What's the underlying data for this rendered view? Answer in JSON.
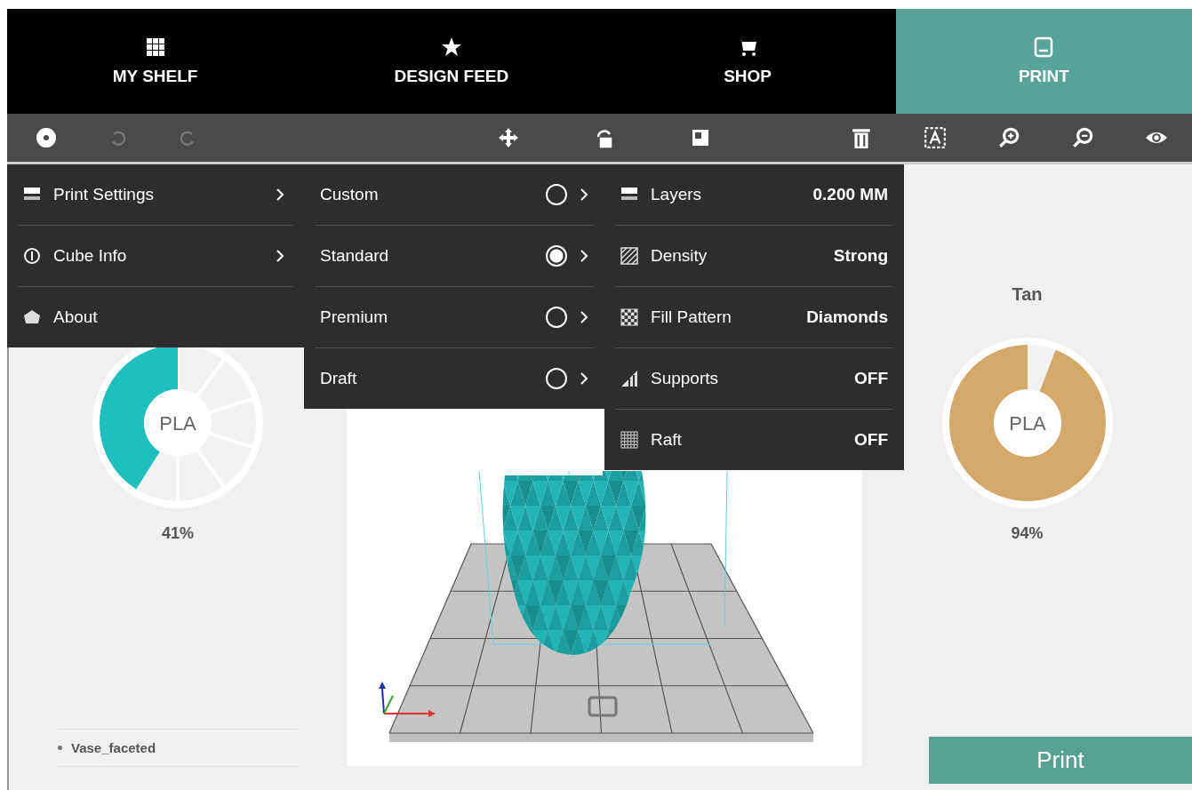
{
  "nav_tabs": [
    {
      "label": "MY SHELF",
      "selected": false
    },
    {
      "label": "DESIGN FEED",
      "selected": false
    },
    {
      "label": "SHOP",
      "selected": false
    },
    {
      "label": "PRINT",
      "selected": true
    }
  ],
  "toolbar": [
    {
      "disabled": false
    },
    {
      "disabled": true
    },
    {
      "disabled": true
    },
    {
      "disabled": false
    },
    {
      "disabled": false
    },
    {
      "disabled": false
    },
    {
      "disabled": false
    },
    {
      "disabled": false
    },
    {
      "disabled": false
    },
    {
      "disabled": false
    },
    {
      "disabled": false
    }
  ],
  "main_menu": [
    {
      "label": "Print Settings",
      "has_submenu": true
    },
    {
      "label": "Cube Info",
      "has_submenu": true
    },
    {
      "label": "About",
      "has_submenu": false
    }
  ],
  "print_profiles": [
    {
      "label": "Custom",
      "selected": false
    },
    {
      "label": "Standard",
      "selected": true
    },
    {
      "label": "Premium",
      "selected": false
    },
    {
      "label": "Draft",
      "selected": false
    }
  ],
  "print_settings": [
    {
      "label": "Layers",
      "value": "0.200 MM"
    },
    {
      "label": "Density",
      "value": "Strong"
    },
    {
      "label": "Fill Pattern",
      "value": "Diamonds"
    },
    {
      "label": "Supports",
      "value": "OFF"
    },
    {
      "label": "Raft",
      "value": "OFF"
    }
  ],
  "materials": [
    {
      "material": "PLA",
      "level": 0.41,
      "percent": "41%",
      "color": "#1fbfbf"
    },
    {
      "name": "Tan",
      "material": "PLA",
      "level": 0.94,
      "percent": "94%",
      "color": "#d4a868"
    }
  ],
  "models": [
    "Vase_faceted"
  ],
  "print_button": "Print"
}
